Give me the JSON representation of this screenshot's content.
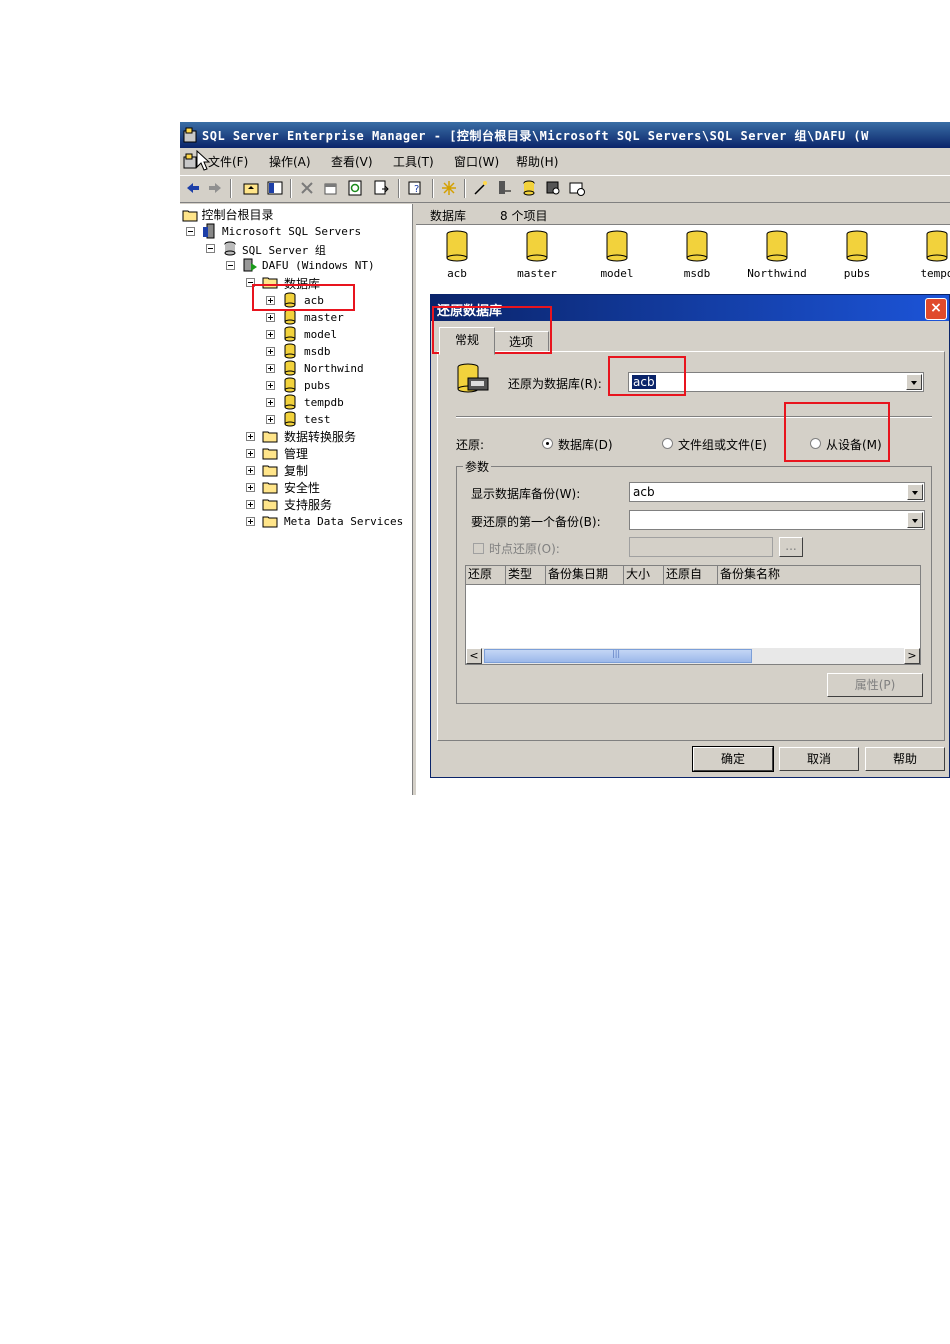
{
  "window": {
    "title": "SQL Server Enterprise Manager - [控制台根目录\\Microsoft SQL Servers\\SQL Server 组\\DAFU (W"
  },
  "menu": {
    "items": [
      "文件(F)",
      "操作(A)",
      "查看(V)",
      "工具(T)",
      "窗口(W)",
      "帮助(H)"
    ]
  },
  "tree": {
    "root": "控制台根目录",
    "servers": "Microsoft SQL Servers",
    "group": "SQL Server 组",
    "server": "DAFU (Windows NT)",
    "databases_folder": "数据库",
    "databases": [
      "acb",
      "master",
      "model",
      "msdb",
      "Northwind",
      "pubs",
      "tempdb",
      "test"
    ],
    "folders": [
      "数据转换服务",
      "管理",
      "复制",
      "安全性",
      "支持服务",
      "Meta Data Services"
    ]
  },
  "list": {
    "header_title": "数据库",
    "header_count": "8 个项目",
    "items": [
      "acb",
      "master",
      "model",
      "msdb",
      "Northwind",
      "pubs",
      "tempd"
    ]
  },
  "dialog": {
    "title": "还原数据库",
    "close": "×",
    "tabs": [
      "常规",
      "选项"
    ],
    "restore_as_label": "还原为数据库(R):",
    "restore_as_value": "acb",
    "restore_label": "还原:",
    "radio_database": "数据库(D)",
    "radio_filegroup": "文件组或文件(E)",
    "radio_device": "从设备(M)",
    "params_label": "参数",
    "show_backup_label": "显示数据库备份(W):",
    "show_backup_value": "acb",
    "first_backup_label": "要还原的第一个备份(B):",
    "first_backup_value": "",
    "point_in_time_label": "时点还原(O):",
    "browse_label": "...",
    "grid_columns": [
      "还原",
      "类型",
      "备份集日期",
      "大小",
      "还原自",
      "备份集名称"
    ],
    "scroll_mid": "|||",
    "properties_button": "属性(P)",
    "ok_button": "确定",
    "cancel_button": "取消",
    "help_button": "帮助"
  },
  "colors": {
    "title_bar": "#0a246a",
    "highlight_box": "#e8141e",
    "db_icon": "#f2d23c"
  }
}
